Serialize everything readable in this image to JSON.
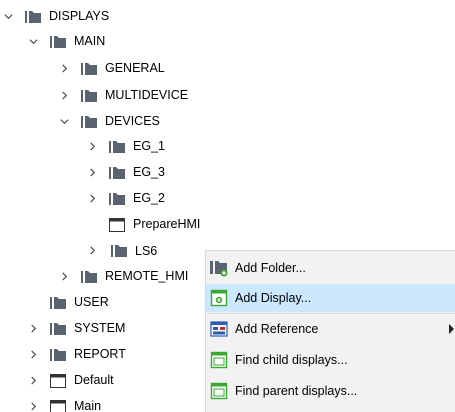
{
  "tree": {
    "items": [
      {
        "label": "DISPLAYS",
        "icon": "folder-icon",
        "expander": "expanded"
      },
      {
        "label": "MAIN",
        "icon": "folder-icon",
        "expander": "expanded"
      },
      {
        "label": "GENERAL",
        "icon": "folder-icon",
        "expander": "collapsed"
      },
      {
        "label": "MULTIDEVICE",
        "icon": "folder-icon",
        "expander": "collapsed"
      },
      {
        "label": "DEVICES",
        "icon": "folder-icon",
        "expander": "expanded"
      },
      {
        "label": "EG_1",
        "icon": "folder-icon",
        "expander": "collapsed"
      },
      {
        "label": "EG_3",
        "icon": "folder-icon",
        "expander": "collapsed"
      },
      {
        "label": "EG_2",
        "icon": "folder-icon",
        "expander": "collapsed"
      },
      {
        "label": "PrepareHMI",
        "icon": "display-icon",
        "expander": "none"
      },
      {
        "label": "LS6",
        "icon": "folder-icon",
        "expander": "collapsed",
        "selected": true
      },
      {
        "label": "REMOTE_HMI",
        "icon": "folder-icon",
        "expander": "collapsed"
      },
      {
        "label": "USER",
        "icon": "folder-icon",
        "expander": "none"
      },
      {
        "label": "SYSTEM",
        "icon": "folder-icon",
        "expander": "collapsed"
      },
      {
        "label": "REPORT",
        "icon": "folder-icon",
        "expander": "collapsed"
      },
      {
        "label": "Default",
        "icon": "display-icon",
        "expander": "collapsed"
      },
      {
        "label": "Main",
        "icon": "display-icon",
        "expander": "collapsed"
      }
    ]
  },
  "context_menu": {
    "items": [
      {
        "label": "Add Folder...",
        "icon": "add-folder-icon"
      },
      {
        "label": "Add Display...",
        "icon": "add-display-icon",
        "highlighted": true
      },
      {
        "label": "Add Reference",
        "icon": "add-reference-icon",
        "submenu": true
      },
      {
        "label": "Find child displays...",
        "icon": "find-child-displays-icon"
      },
      {
        "label": "Find parent displays...",
        "icon": "find-parent-displays-icon"
      }
    ]
  },
  "colors": {
    "folder": "#5a6470",
    "selection": "#cce8ff",
    "menu_bg": "#f2f2f2",
    "display_icon_green": "#3aa832"
  }
}
